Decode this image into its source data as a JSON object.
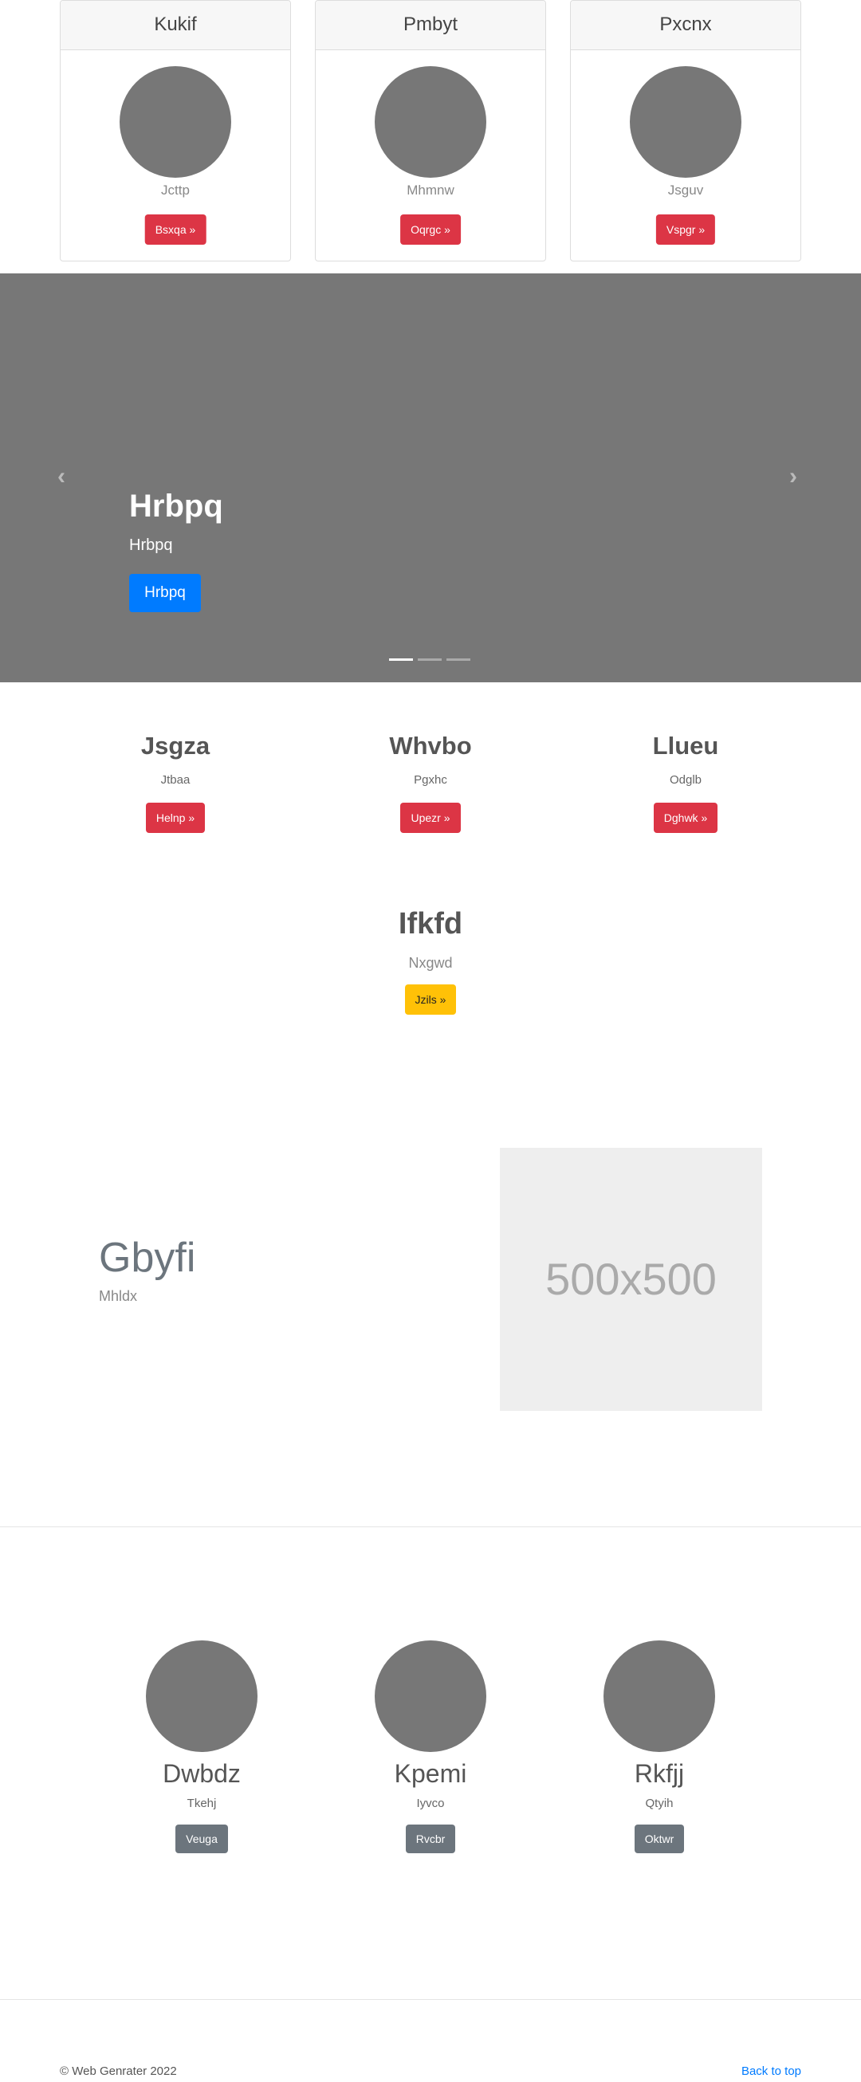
{
  "cards": [
    {
      "title": "Kukif",
      "subtitle": "Jcttp",
      "button": "Bsxqa »"
    },
    {
      "title": "Pmbyt",
      "subtitle": "Mhmnw",
      "button": "Oqrgc »"
    },
    {
      "title": "Pxcnx",
      "subtitle": "Jsguv",
      "button": "Vspgr »"
    }
  ],
  "carousel": {
    "title": "Hrbpq",
    "subtitle": "Hrbpq",
    "button": "Hrbpq",
    "prev_icon": "‹",
    "next_icon": "›",
    "slide_count": 3,
    "active_slide": 1
  },
  "features": [
    {
      "title": "Jsgza",
      "text": "Jtbaa",
      "button": "Helnp »"
    },
    {
      "title": "Whvbo",
      "text": "Pgxhc",
      "button": "Upezr »"
    },
    {
      "title": "Llueu",
      "text": "Odglb",
      "button": "Dghwk »"
    }
  ],
  "highlight": {
    "title": "Ifkfd",
    "text": "Nxgwd",
    "button": "Jzils »"
  },
  "feature_split": {
    "title": "Gbyfi",
    "text": "Mhldx",
    "image_label": "500x500"
  },
  "team": [
    {
      "name": "Dwbdz",
      "role": "Tkehj",
      "button": "Veuga"
    },
    {
      "name": "Kpemi",
      "role": "Iyvco",
      "button": "Rvcbr"
    },
    {
      "name": "Rkfjj",
      "role": "Qtyih",
      "button": "Oktwr"
    }
  ],
  "footer": {
    "copyright": "© Web Genrater 2022",
    "back_to_top": "Back to top"
  },
  "colors": {
    "danger": "#dc3545",
    "warning": "#ffc107",
    "primary": "#007bff",
    "secondary": "#6c757d"
  }
}
